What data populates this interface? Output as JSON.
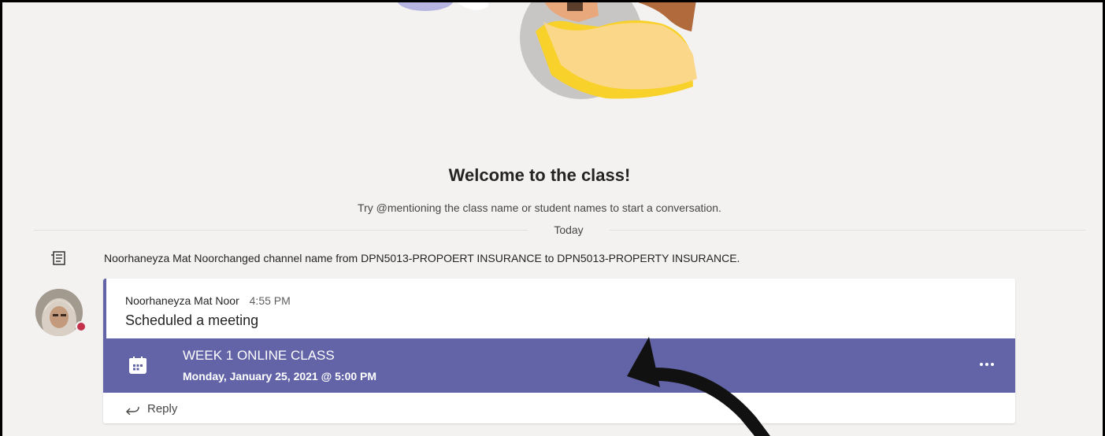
{
  "welcome": {
    "title": "Welcome to the class!",
    "subtitle": "Try @mentioning the class name or student names to start a conversation."
  },
  "divider": {
    "label": "Today"
  },
  "system_event": {
    "actor": "Noorhaneyza Mat Noor",
    "text": " changed channel name from DPN5013-PROPOERT INSURANCE to DPN5013-PROPERTY INSURANCE."
  },
  "message": {
    "author": "Noorhaneyza Mat Noor",
    "time": "4:55 PM",
    "body": "Scheduled a meeting",
    "presence_status": "busy",
    "meeting": {
      "title": "WEEK 1 ONLINE CLASS",
      "datetime": "Monday, January 25, 2021 @ 5:00 PM",
      "more_label": "···"
    },
    "reply_label": "Reply"
  },
  "icons": {
    "system": "channel-rename-icon",
    "calendar": "calendar-icon",
    "reply": "reply-arrow-icon",
    "more": "more-options-icon"
  },
  "colors": {
    "background": "#f3f2f1",
    "accent": "#6264a7",
    "presence_busy": "#c4314b"
  }
}
